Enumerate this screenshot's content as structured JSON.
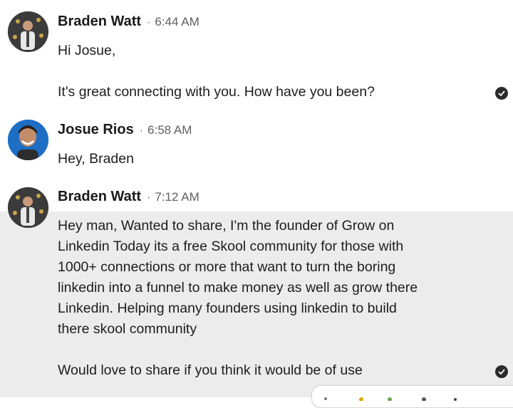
{
  "messages": [
    {
      "sender": "Braden Watt",
      "time": "6:44 AM",
      "lines": [
        "Hi Josue,",
        "It's great connecting with you. How have you been?"
      ]
    },
    {
      "sender": "Josue Rios",
      "time": "6:58 AM",
      "lines": [
        "Hey, Braden"
      ]
    },
    {
      "sender": "Braden Watt",
      "time": "7:12 AM",
      "lines": [
        "Hey man, Wanted to share, I'm the founder of Grow on",
        "Linkedin Today its a free Skool community for those with",
        "1000+ connections or more that want to turn the boring",
        "linkedin into a funnel to make money as well as grow there",
        "Linkedin. Helping many founders using linkedin to build",
        "there skool community",
        "Would love to share if you think it would be of use"
      ]
    }
  ],
  "separator": "·",
  "icons": {
    "read_receipt": "check-circle-icon",
    "reaction_bar": "reaction-bar"
  },
  "colors": {
    "highlight_bg": "#ececec",
    "check_bg": "#2b2b2b"
  }
}
